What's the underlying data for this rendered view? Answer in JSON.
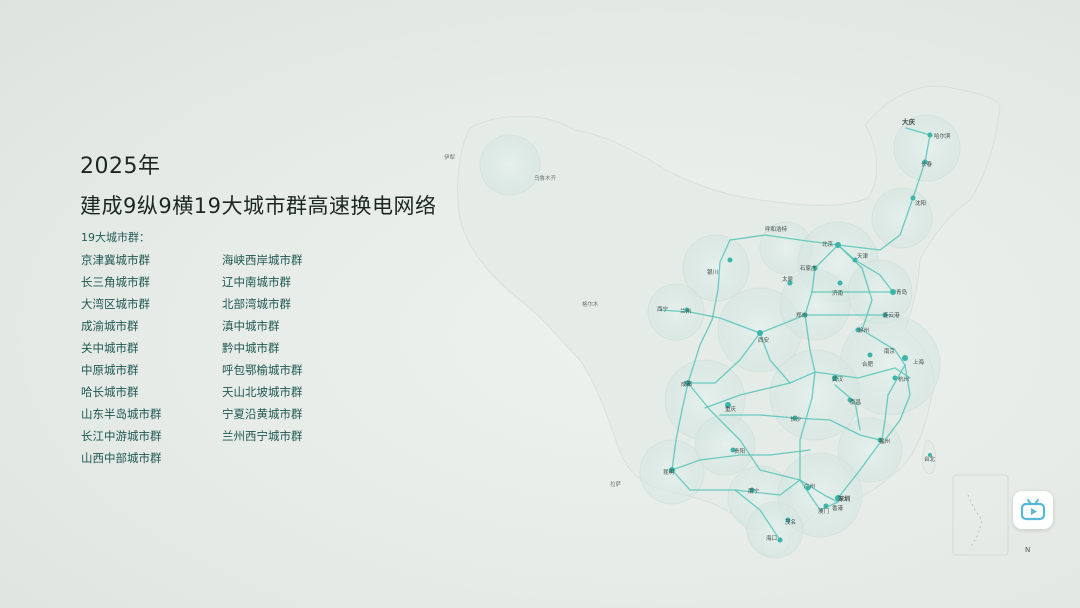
{
  "headline": {
    "year": "2025年",
    "subtitle": "建成9纵9横19大城市群高速换电网络"
  },
  "clusters": {
    "heading": "19大城市群：",
    "column1": [
      "京津冀城市群",
      "长三角城市群",
      "大湾区城市群",
      "成渝城市群",
      "关中城市群",
      "中原城市群",
      "哈长城市群",
      "山东半岛城市群",
      "长江中游城市群",
      "山西中部城市群"
    ],
    "column2": [
      "海峡西岸城市群",
      "辽中南城市群",
      "北部湾城市群",
      "滇中城市群",
      "黔中城市群",
      "呼包鄂榆城市群",
      "天山北坡城市群",
      "宁夏沿黄城市群",
      "兰州西宁城市群"
    ]
  },
  "map": {
    "colors": {
      "land": "#e4eae6",
      "route": "#4fc1b4",
      "node": "#36b2a5",
      "cluster_fill": "#dbeae6",
      "label": "#3d4a46"
    },
    "cities": [
      {
        "name": "大庆",
        "bold": true
      },
      {
        "name": "哈尔滨"
      },
      {
        "name": "长春"
      },
      {
        "name": "沈阳"
      },
      {
        "name": "呼和浩特"
      },
      {
        "name": "北京"
      },
      {
        "name": "天津"
      },
      {
        "name": "石家庄"
      },
      {
        "name": "银川"
      },
      {
        "name": "太原"
      },
      {
        "name": "济南"
      },
      {
        "name": "青岛"
      },
      {
        "name": "西宁"
      },
      {
        "name": "兰州"
      },
      {
        "name": "郑州"
      },
      {
        "name": "连云港"
      },
      {
        "name": "西安"
      },
      {
        "name": "徐州"
      },
      {
        "name": "合肥"
      },
      {
        "name": "上海"
      },
      {
        "name": "南京"
      },
      {
        "name": "武汉"
      },
      {
        "name": "杭州"
      },
      {
        "name": "成都"
      },
      {
        "name": "重庆"
      },
      {
        "name": "南昌"
      },
      {
        "name": "长沙"
      },
      {
        "name": "福州"
      },
      {
        "name": "贵阳"
      },
      {
        "name": "昆明"
      },
      {
        "name": "南宁"
      },
      {
        "name": "广州"
      },
      {
        "name": "深圳",
        "bold": true
      },
      {
        "name": "香港"
      },
      {
        "name": "澳门"
      },
      {
        "name": "茂名"
      },
      {
        "name": "海口"
      },
      {
        "name": "台北"
      },
      {
        "name": "伊犁"
      },
      {
        "name": "乌鲁木齐"
      },
      {
        "name": "格尔木"
      },
      {
        "name": "拉萨"
      }
    ]
  },
  "watermark": {
    "name": "bilibili-tv-icon"
  },
  "compass": {
    "label": "N"
  }
}
